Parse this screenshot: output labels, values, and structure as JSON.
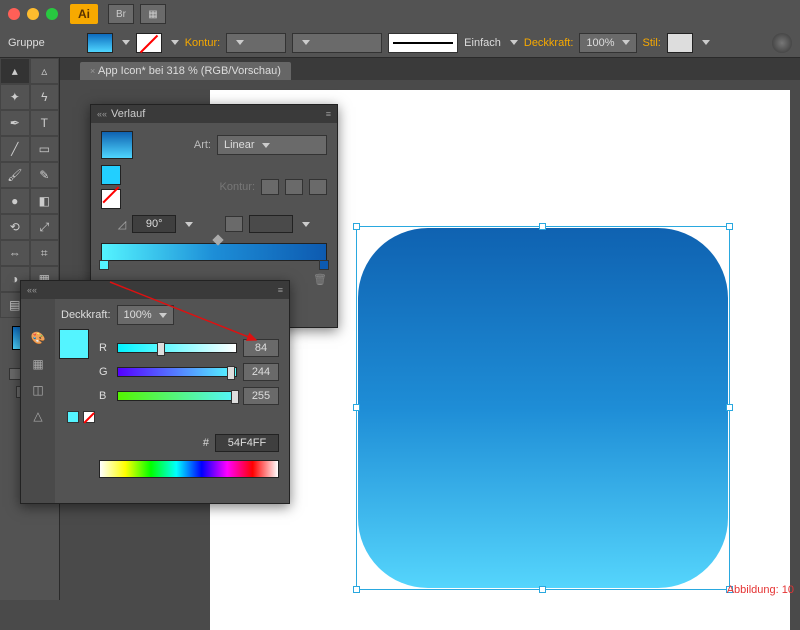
{
  "titlebar": {
    "app_abbrev": "Ai"
  },
  "ctrlbar": {
    "selection_label": "Gruppe",
    "stroke_label": "Kontur:",
    "stroke_style": "Einfach",
    "opacity_label": "Deckkraft:",
    "opacity_value": "100%",
    "style_label": "Stil:"
  },
  "doc_tab": "App Icon* bei 318 % (RGB/Vorschau)",
  "gradient_panel": {
    "title": "Verlauf",
    "type_label": "Art:",
    "type_value": "Linear",
    "stroke_label": "Kontur:",
    "angle_value": "90°"
  },
  "color_panel": {
    "opacity_label": "Deckkraft:",
    "opacity_value": "100%",
    "channels": {
      "r": {
        "label": "R",
        "value": "84",
        "knob_pct": 33
      },
      "g": {
        "label": "G",
        "value": "244",
        "knob_pct": 95
      },
      "b": {
        "label": "B",
        "value": "255",
        "knob_pct": 100
      }
    },
    "hex_prefix": "#",
    "hex_value": "54F4FF"
  },
  "figure_caption": "Abbildung: 10",
  "colors": {
    "grad_top": "#0f62b1",
    "grad_bottom": "#55d5fc",
    "stop_left": "#54f4ff",
    "accent": "#f7a900"
  }
}
